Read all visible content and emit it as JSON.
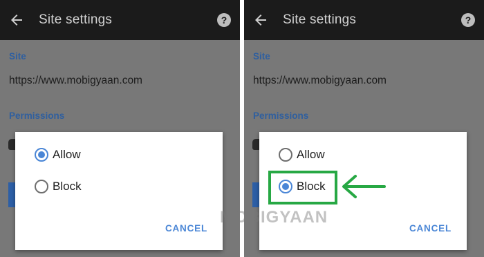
{
  "panels": [
    {
      "app_bar": {
        "title": "Site settings",
        "back_icon": "arrow-left-icon",
        "help_icon": "help-circle-icon"
      },
      "site_label": "Site",
      "site_url": "https://www.mobigyaan.com",
      "permissions_label": "Permissions",
      "dialog": {
        "options": [
          {
            "label": "Allow",
            "selected": true
          },
          {
            "label": "Block",
            "selected": false
          }
        ],
        "cancel_label": "CANCEL"
      }
    },
    {
      "app_bar": {
        "title": "Site settings",
        "back_icon": "arrow-left-icon",
        "help_icon": "help-circle-icon"
      },
      "site_label": "Site",
      "site_url": "https://www.mobigyaan.com",
      "permissions_label": "Permissions",
      "dialog": {
        "options": [
          {
            "label": "Allow",
            "selected": false
          },
          {
            "label": "Block",
            "selected": true
          }
        ],
        "cancel_label": "CANCEL"
      }
    }
  ],
  "annotation": {
    "color": "#27a844",
    "highlight": "Block option",
    "arrow_icon": "arrow-left-icon"
  },
  "watermark": "MOBIGYAAN",
  "colors": {
    "app_bar": "#1b1b1b",
    "accent": "#4a86d6",
    "section_label": "#2f5f9f",
    "scrim": "#787878"
  }
}
